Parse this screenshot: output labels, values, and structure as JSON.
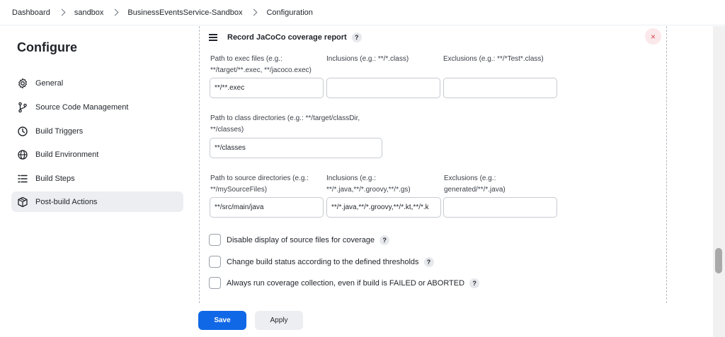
{
  "breadcrumb": [
    "Dashboard",
    "sandbox",
    "BusinessEventsService-Sandbox",
    "Configuration"
  ],
  "sidebar": {
    "title": "Configure",
    "items": [
      {
        "label": "General",
        "icon": "gear-icon",
        "active": false
      },
      {
        "label": "Source Code Management",
        "icon": "branch-icon",
        "active": false
      },
      {
        "label": "Build Triggers",
        "icon": "clock-icon",
        "active": false
      },
      {
        "label": "Build Environment",
        "icon": "globe-icon",
        "active": false
      },
      {
        "label": "Build Steps",
        "icon": "list-icon",
        "active": false
      },
      {
        "label": "Post-build Actions",
        "icon": "package-icon",
        "active": true
      }
    ]
  },
  "section": {
    "title": "Record JaCoCo coverage report",
    "help": "?",
    "close": "×",
    "exec_path": {
      "label_line1": "Path to exec files (e.g.:",
      "label_line2": "**/target/**.exec, **/jacoco.exec)",
      "value": "**/**.exec"
    },
    "exec_inclusions": {
      "label": "Inclusions (e.g.: **/*.class)",
      "value": ""
    },
    "exec_exclusions": {
      "label": "Exclusions (e.g.: **/*Test*.class)",
      "value": ""
    },
    "class_dirs": {
      "label_line1": "Path to class directories (e.g.: **/target/classDir,",
      "label_line2": "**/classes)",
      "value": "**/classes"
    },
    "source_dirs": {
      "label_line1": "Path to source directories (e.g.:",
      "label_line2": "**/mySourceFiles)",
      "value": "**/src/main/java"
    },
    "source_inclusions": {
      "label_line1": "Inclusions (e.g.:",
      "label_line2": "**/*.java,**/*.groovy,**/*.gs)",
      "value": "**/*.java,**/*.groovy,**/*.kt,**/*.k"
    },
    "source_exclusions": {
      "label_line1": "Exclusions (e.g.:",
      "label_line2": "generated/**/*.java)",
      "value": ""
    },
    "checkboxes": [
      {
        "label": "Disable display of source files for coverage",
        "checked": false
      },
      {
        "label": "Change build status according to the defined thresholds",
        "checked": false
      },
      {
        "label": "Always run coverage collection, even if build is FAILED or ABORTED",
        "checked": false
      }
    ]
  },
  "actions": {
    "save": "Save",
    "apply": "Apply"
  },
  "colors": {
    "primary": "#1068e6",
    "active_bg": "#eceef2",
    "close_bg": "#fbe8ea",
    "close_fg": "#d64550"
  }
}
